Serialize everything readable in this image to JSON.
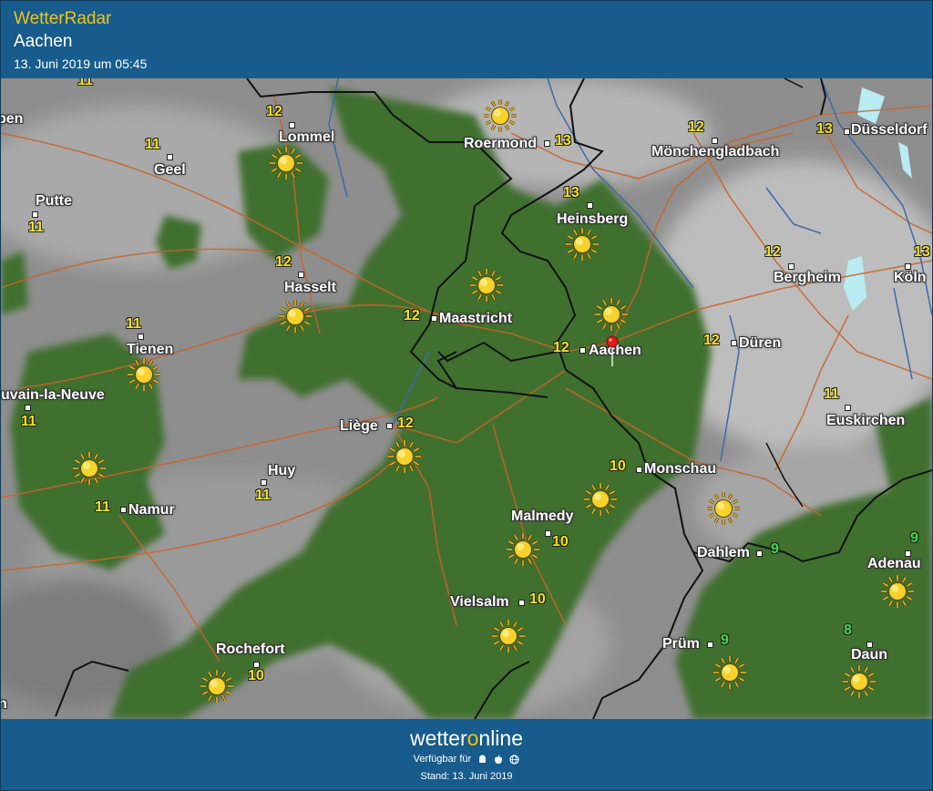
{
  "header": {
    "app_title": "WetterRadar",
    "location": "Aachen",
    "timestamp": "13. Juni 2019 um 05:45"
  },
  "map": {
    "selected_location": "Aachen",
    "places": [
      {
        "id": "lommel",
        "name": "Lommel",
        "temp": "12"
      },
      {
        "id": "geel",
        "name": "Geel",
        "temp": "11"
      },
      {
        "id": "putte",
        "name": "Putte",
        "temp": "11"
      },
      {
        "id": "roermond",
        "name": "Roermond",
        "temp": "13"
      },
      {
        "id": "moenchengladbach",
        "name": "Mönchengladbach",
        "temp": "12"
      },
      {
        "id": "duesseldorf",
        "name": "Düsseldorf",
        "temp": "13"
      },
      {
        "id": "heinsberg",
        "name": "Heinsberg",
        "temp": "13"
      },
      {
        "id": "hasselt",
        "name": "Hasselt",
        "temp": "12"
      },
      {
        "id": "bergheim",
        "name": "Bergheim",
        "temp": "12"
      },
      {
        "id": "koeln",
        "name": "Köln",
        "temp": "13"
      },
      {
        "id": "maastricht",
        "name": "Maastricht",
        "temp": "12"
      },
      {
        "id": "tienen",
        "name": "Tienen",
        "temp": "11"
      },
      {
        "id": "aachen",
        "name": "Aachen",
        "temp": "12"
      },
      {
        "id": "dueren",
        "name": "Düren",
        "temp": "12"
      },
      {
        "id": "louvain",
        "name": "uvain-la-Neuve",
        "temp": "11"
      },
      {
        "id": "euskirchen",
        "name": "Euskirchen",
        "temp": "11"
      },
      {
        "id": "liege",
        "name": "Liège",
        "temp": "12"
      },
      {
        "id": "huy",
        "name": "Huy",
        "temp": "11"
      },
      {
        "id": "monschau",
        "name": "Monschau",
        "temp": "10"
      },
      {
        "id": "namur",
        "name": "Namur",
        "temp": "11"
      },
      {
        "id": "malmedy",
        "name": "Malmedy",
        "temp": "10"
      },
      {
        "id": "dahlem",
        "name": "Dahlem",
        "temp": "9"
      },
      {
        "id": "adenau",
        "name": "Adenau",
        "temp": "9"
      },
      {
        "id": "vielsalm",
        "name": "Vielsalm",
        "temp": "10"
      },
      {
        "id": "pruem",
        "name": "Prüm",
        "temp": "9"
      },
      {
        "id": "daun",
        "name": "Daun",
        "temp": "8"
      },
      {
        "id": "rochefort",
        "name": "Rochefort",
        "temp": "10"
      },
      {
        "id": "edge-top",
        "name": "",
        "temp": "11"
      },
      {
        "id": "edge-left",
        "name": "pen",
        "temp": ""
      },
      {
        "id": "edge-bottom",
        "name": "n",
        "temp": ""
      }
    ],
    "weather_icons": [
      "sun",
      "sun",
      "sun",
      "sun",
      "sun",
      "sun",
      "sun",
      "sun",
      "sun",
      "sun",
      "sun",
      "sun",
      "sun",
      "sun",
      "sun",
      "sun",
      "sun",
      "sun",
      "sun",
      "sun",
      "sun"
    ],
    "colors": {
      "warm_temp": "#f4e21a",
      "cool_temp": "#3fd94a",
      "land_green": "#3f6d2e",
      "cloud_grey": "#9a9a9a",
      "roads": "#c8642a",
      "rivers": "#3c6aa6",
      "borders": "#111111"
    }
  },
  "footer": {
    "brand_prefix": "wetter",
    "brand_o": "o",
    "brand_suffix": "nline",
    "available_text": "Verfügbar für",
    "platform_icons": [
      "android-icon",
      "apple-icon",
      "web-icon"
    ],
    "stand": "Stand: 13. Juni 2019"
  }
}
